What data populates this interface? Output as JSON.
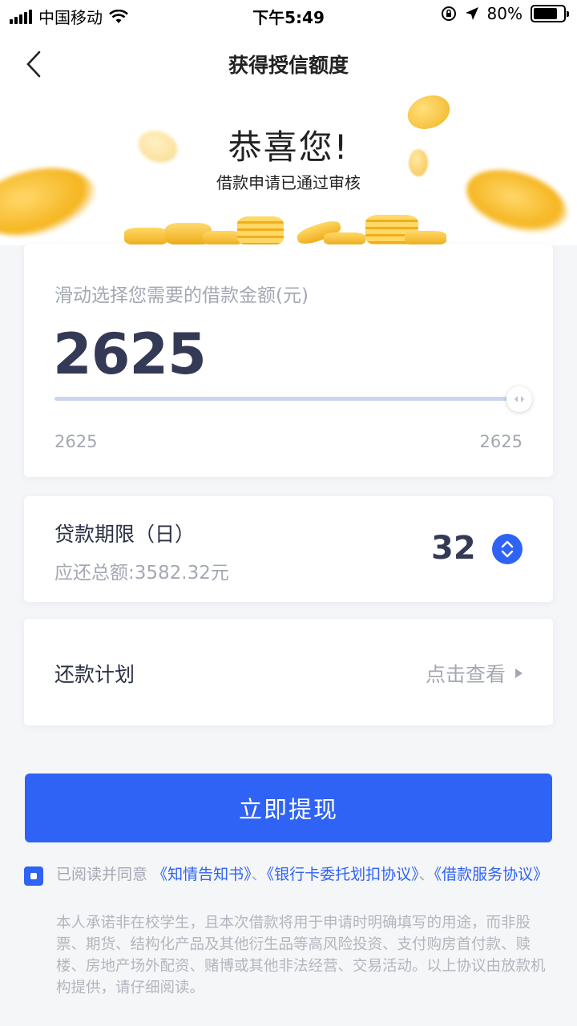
{
  "status_bar": {
    "carrier": "中国移动",
    "time": "下午5:49",
    "battery": "80%",
    "battery_level": 0.8
  },
  "header": {
    "title": "获得授信额度",
    "congrats": "恭喜您!",
    "subtitle": "借款申请已通过审核"
  },
  "amount_card": {
    "hint": "滑动选择您需要的借款金额(元)",
    "value": "2625",
    "slider_level": 1.0,
    "range_min": "2625",
    "range_max": "2625"
  },
  "term_card": {
    "label": "贷款期限（日）",
    "total": "应还总额:3582.32元",
    "value": "32"
  },
  "plan_card": {
    "label": "还款计划",
    "link": "点击查看"
  },
  "submit": {
    "label": "立即提现"
  },
  "agreement": {
    "checked": true,
    "prefix": "已阅读并同意",
    "link1": "《知情告知书》",
    "sep1": "、",
    "link2": "《银行卡委托划扣协议》",
    "sep2": "、",
    "link3": "《借款服务协议》",
    "disclaimer": "本人承诺非在校学生，且本次借款将用于申请时明确填写的用途，而非股票、期货、结构化产品及其他衍生品等高风险投资、支付购房首付款、赎楼、房地产场外配资、赌博或其他非法经营、交易活动。以上协议由放款机构提供，请仔细阅读。"
  },
  "colors": {
    "accent": "#2f63f5",
    "text_dark": "#343a55",
    "text_muted": "#a4a8b3",
    "coin_gold": "#f7c33a"
  }
}
